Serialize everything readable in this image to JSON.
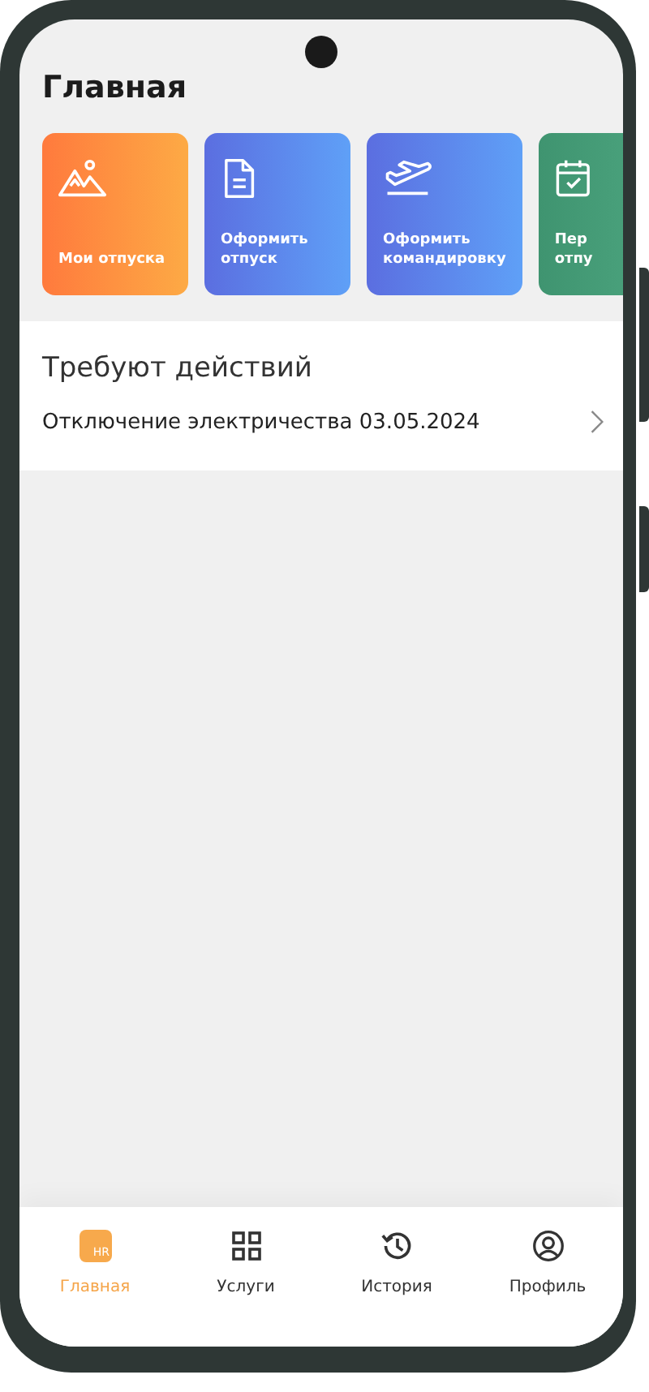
{
  "header": {
    "title": "Главная"
  },
  "tiles": [
    {
      "kind": "mountains",
      "lines": [
        "Мои отпуска"
      ]
    },
    {
      "kind": "document",
      "lines": [
        "Оформить",
        "отпуск"
      ]
    },
    {
      "kind": "plane",
      "lines": [
        "Оформить",
        "командировку"
      ]
    },
    {
      "kind": "calendar",
      "lines": [
        "Пер",
        "отпу"
      ]
    }
  ],
  "action_section": {
    "title": "Требуют действий",
    "items": [
      {
        "text": "Отключение электричества 03.05.2024"
      }
    ]
  },
  "tab_bar": [
    {
      "kind": "home",
      "label": "Главная",
      "badge": "HR",
      "selected": true
    },
    {
      "kind": "grid",
      "label": "Услуги",
      "selected": false
    },
    {
      "kind": "history",
      "label": "История",
      "selected": false
    },
    {
      "kind": "profile",
      "label": "Профиль",
      "selected": false
    }
  ]
}
